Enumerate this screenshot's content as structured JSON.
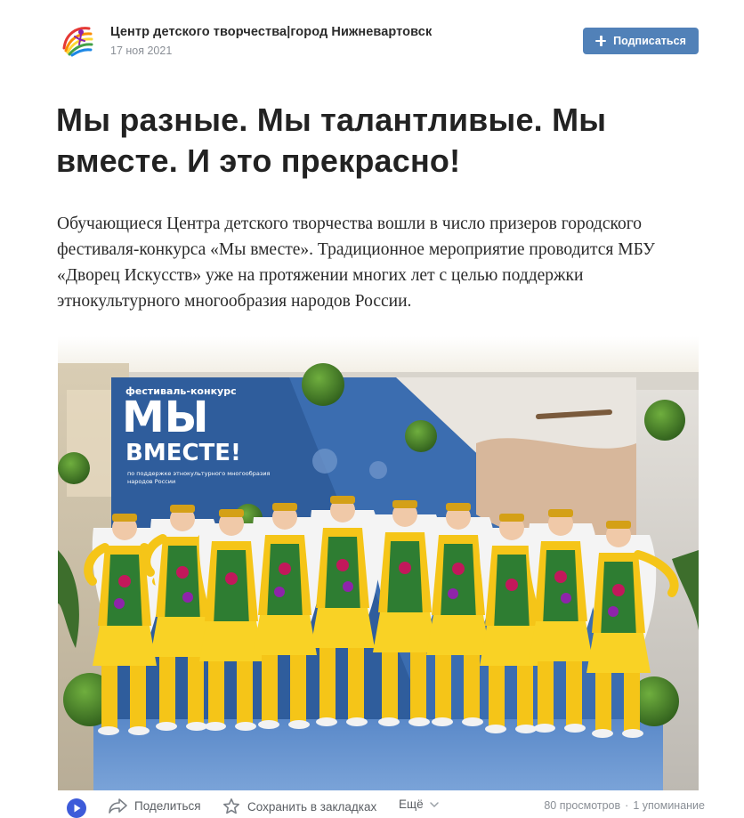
{
  "author": {
    "name": "Центр детского творчества|город Нижневартовск",
    "date": "17 ноя 2021"
  },
  "subscribe": {
    "label": "Подписаться"
  },
  "article": {
    "title": "Мы разные. Мы талантливые. Мы вместе. И это прекрасно!",
    "body": "Обучающиеся Центра детского творчества вошли в число призеров городского фестиваля-конкурса «Мы вместе». Традиционное мероприятие проводится МБУ «Дворец Искусств» уже на протяжении многих лет с целью поддержки этнокультурного многообразия народов России."
  },
  "photo": {
    "banner_small": "фестиваль-конкурс",
    "banner_big1": "МЫ",
    "banner_big2": "ВМЕСТЕ!",
    "banner_sub1": "по поддержке этнокультурного многообразия",
    "banner_sub2": "народов России"
  },
  "footer": {
    "share_label": "Поделиться",
    "bookmark_label": "Сохранить в закладках",
    "more_label": "Ещё",
    "views": "80 просмотров",
    "separator": "·",
    "mentions": "1 упоминание"
  },
  "colors": {
    "accent": "#5181b8",
    "banner_blue": "#2f5d9c",
    "dress_green": "#2e7d32",
    "dress_yellow": "#f5c518"
  },
  "icons": {
    "share": "share-arrow-icon",
    "bookmark": "star-icon",
    "more": "chevron-down-icon",
    "app": "play-icon"
  }
}
